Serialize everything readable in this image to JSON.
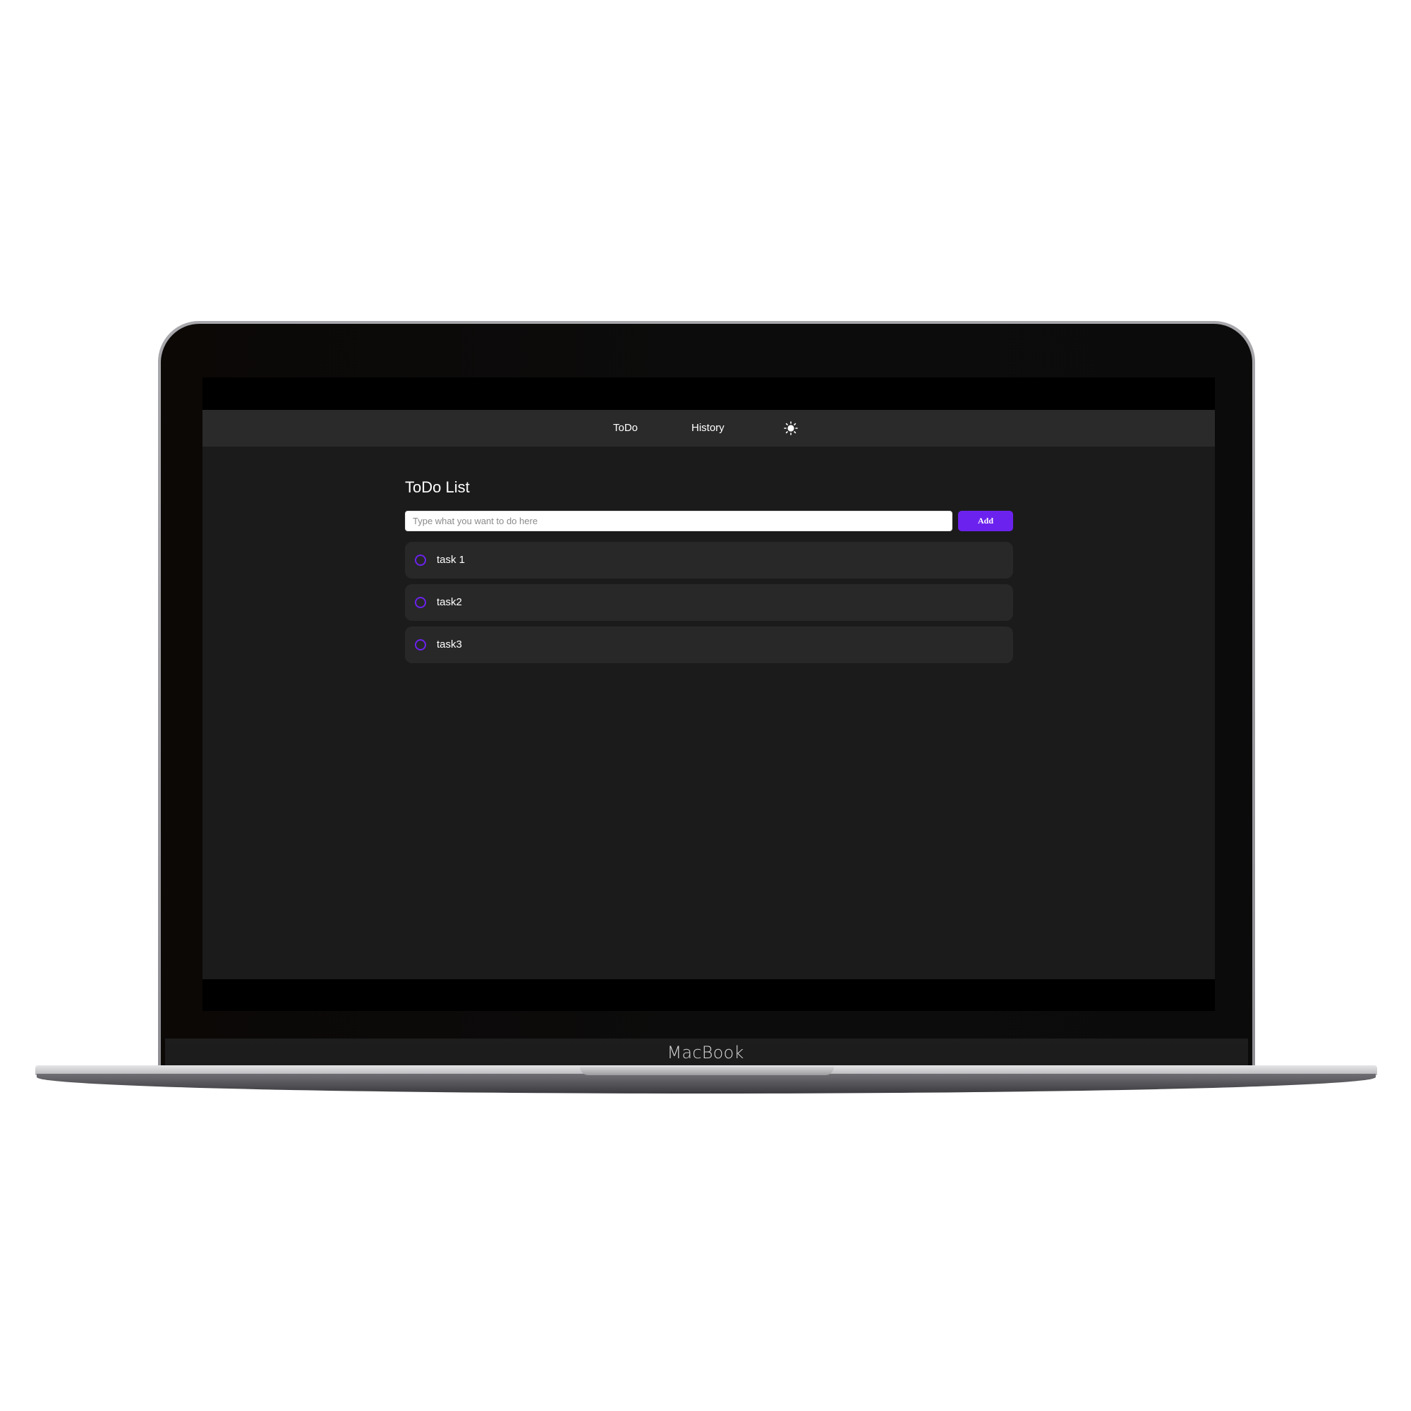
{
  "device": {
    "brand_label": "MacBook"
  },
  "navbar": {
    "links": [
      {
        "label": "ToDo"
      },
      {
        "label": "History"
      }
    ],
    "theme_toggle_icon": "sun-icon"
  },
  "main": {
    "title": "ToDo List",
    "input": {
      "value": "",
      "placeholder": "Type what you want to do here"
    },
    "add_button_label": "Add",
    "tasks": [
      {
        "label": "task 1",
        "completed": false
      },
      {
        "label": "task2",
        "completed": false
      },
      {
        "label": "task3",
        "completed": false
      }
    ]
  },
  "colors": {
    "accent": "#6c22ee",
    "app_background": "#1b1b1b",
    "navbar_background": "#2a2a2a",
    "task_background": "#282828"
  }
}
